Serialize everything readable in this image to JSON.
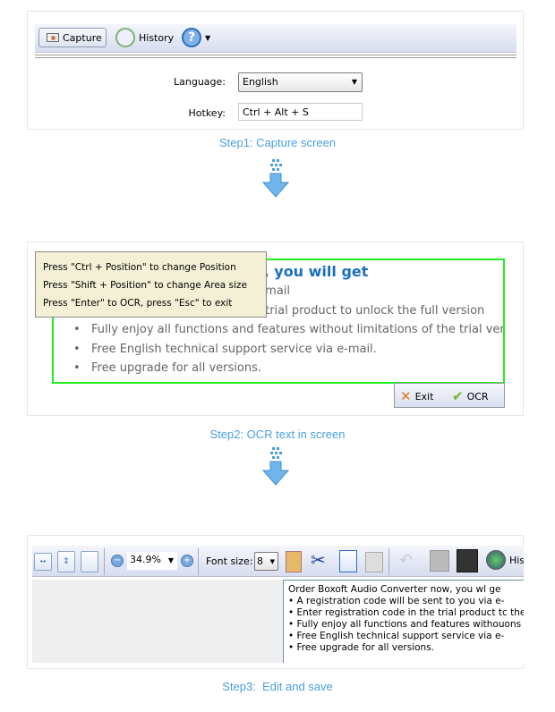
{
  "step1": {
    "toolbar": {
      "capture": "Capture",
      "history": "History",
      "help_icon": "help-icon"
    },
    "language_label": "Language:",
    "language_value": "English",
    "hotkey_label": "Hotkey:",
    "hotkey_value": "Ctrl + Alt + S",
    "caption": "Step1: Capture screen"
  },
  "step2": {
    "heading": "Order Boxoft Audio Converter now, you will get",
    "items": [
      "A registration code will be sent to you via e-mail",
      "Enter registration code in the trial product to unlock the full version",
      "Fully enjoy all functions and features without limitations of the trial version.",
      "Free English technical support service via e-mail.",
      "Free upgrade for all versions."
    ],
    "tooltip": [
      "Press \"Ctrl + Position\" to change Position",
      "Press \"Shift + Position\" to change Area size",
      "Press \"Enter\" to OCR, press \"Esc\" to exit"
    ],
    "exit": "Exit",
    "ocr": "OCR",
    "selection_color": "#22ee22",
    "caption": "Step2: OCR text in screen"
  },
  "step3": {
    "zoom": "34.9%",
    "font_size_label": "Font size:",
    "font_size": "8",
    "history": "His",
    "lines": [
      "Order Boxoft Audio Converter now, you wl ge",
      "• A registration code will be sent to you via e-",
      "• Enter registration code in the trial product tc the full",
      "• Fully enjoy all functions and features withouons of th",
      "• Free English technical support service via e-",
      "• Free upgrade for all versions."
    ],
    "caption": "Step3:  Edit and save"
  },
  "colors": {
    "caption": "#4a9ee0",
    "heading": "#1a6fbf"
  }
}
